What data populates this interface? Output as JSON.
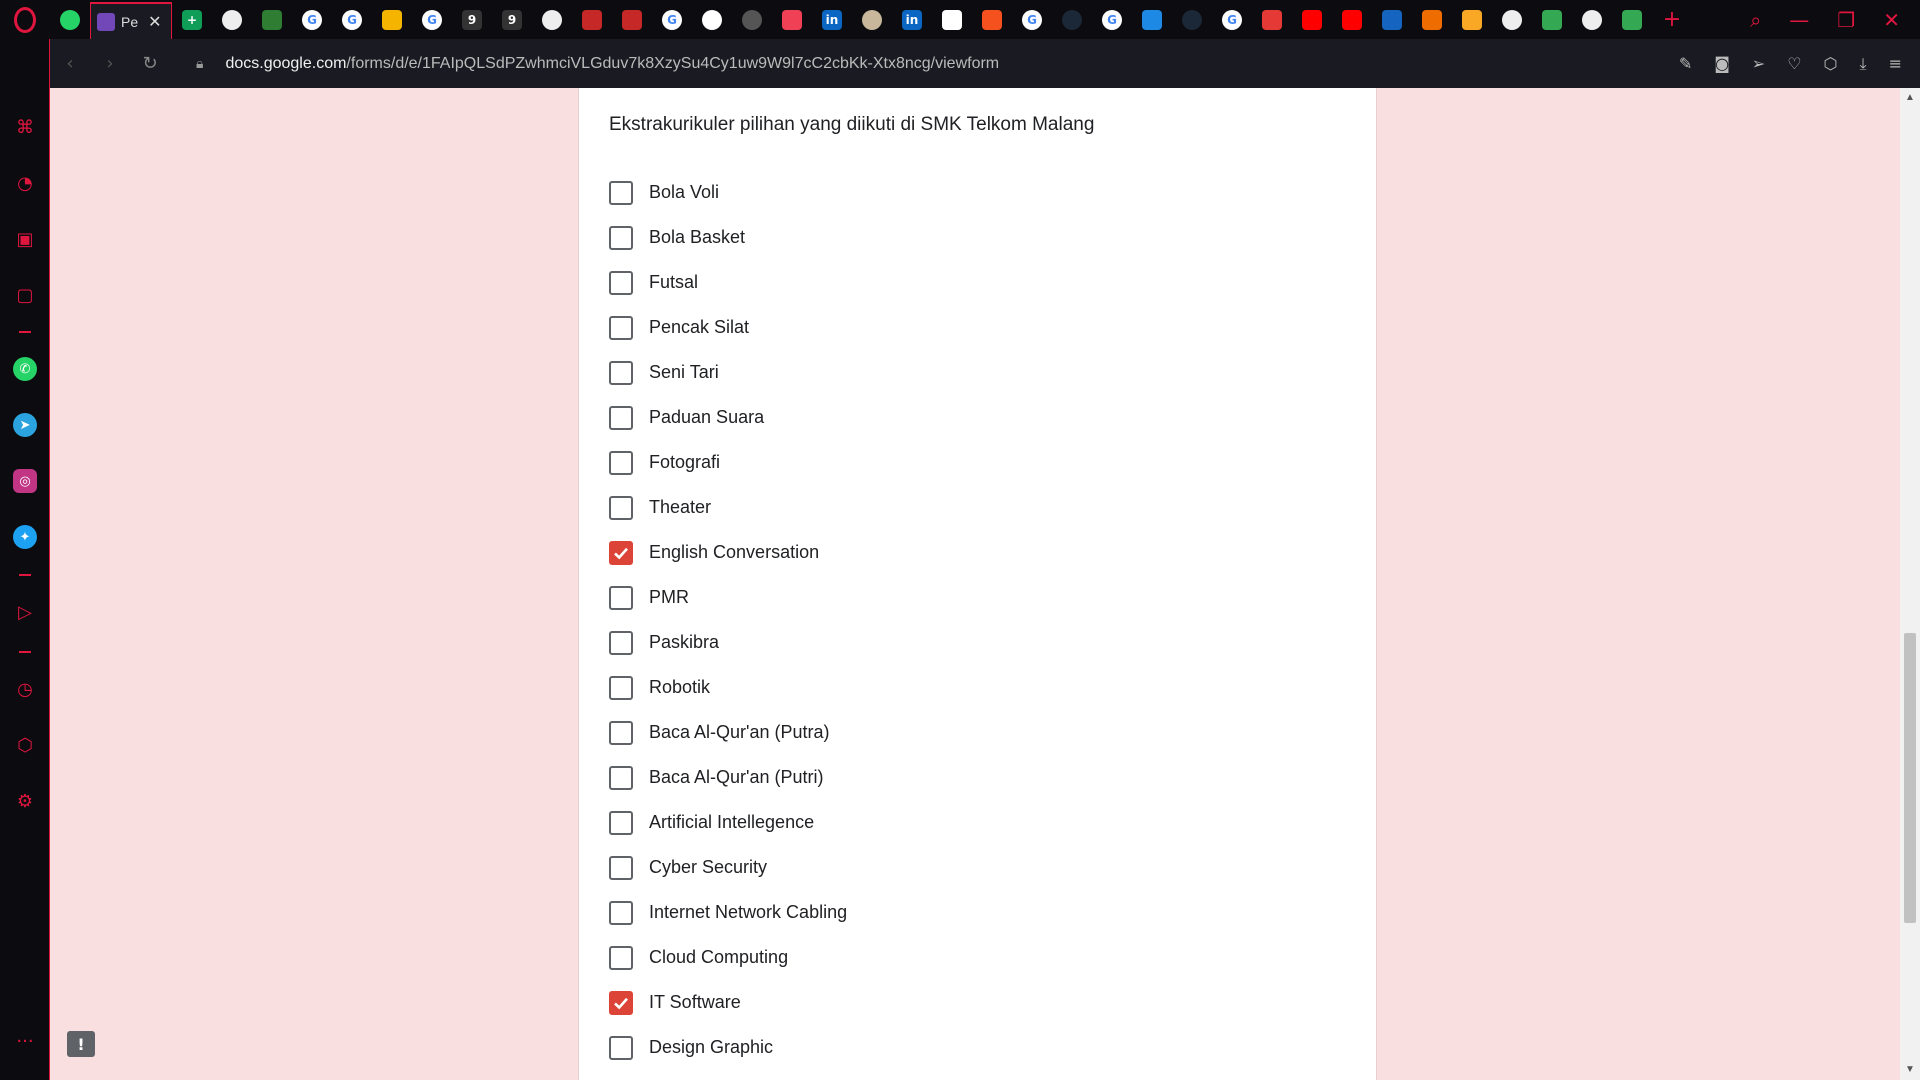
{
  "browser": {
    "active_tab_title": "Pe",
    "url_host": "docs.google.com",
    "url_path": "/forms/d/e/1FAIpQLSdPZwhmciVLGduv7k8XzySu4Cy1uw9W9l7cC2cbKk-Xtx8ncg/viewform",
    "accent_color": "#e0163f"
  },
  "form": {
    "question": "Ekstrakurikuler  pilihan yang diikuti di SMK Telkom Malang",
    "options": [
      {
        "label": "Bola Voli",
        "checked": false
      },
      {
        "label": "Bola Basket",
        "checked": false
      },
      {
        "label": "Futsal",
        "checked": false
      },
      {
        "label": "Pencak Silat",
        "checked": false
      },
      {
        "label": "Seni Tari",
        "checked": false
      },
      {
        "label": "Paduan Suara",
        "checked": false
      },
      {
        "label": "Fotografi",
        "checked": false
      },
      {
        "label": "Theater",
        "checked": false
      },
      {
        "label": "English Conversation",
        "checked": true
      },
      {
        "label": "PMR",
        "checked": false
      },
      {
        "label": "Paskibra",
        "checked": false
      },
      {
        "label": "Robotik",
        "checked": false
      },
      {
        "label": "Baca Al-Qur'an (Putra)",
        "checked": false
      },
      {
        "label": "Baca Al-Qur'an (Putri)",
        "checked": false
      },
      {
        "label": "Artificial Intellegence",
        "checked": false
      },
      {
        "label": "Cyber Security",
        "checked": false
      },
      {
        "label": "Internet Network Cabling",
        "checked": false
      },
      {
        "label": "Cloud Computing",
        "checked": false
      },
      {
        "label": "IT Software",
        "checked": true
      },
      {
        "label": "Design Graphic",
        "checked": false
      }
    ],
    "checked_color": "#db4437",
    "background_color": "#f9dfe0"
  },
  "feedback_label": "!"
}
